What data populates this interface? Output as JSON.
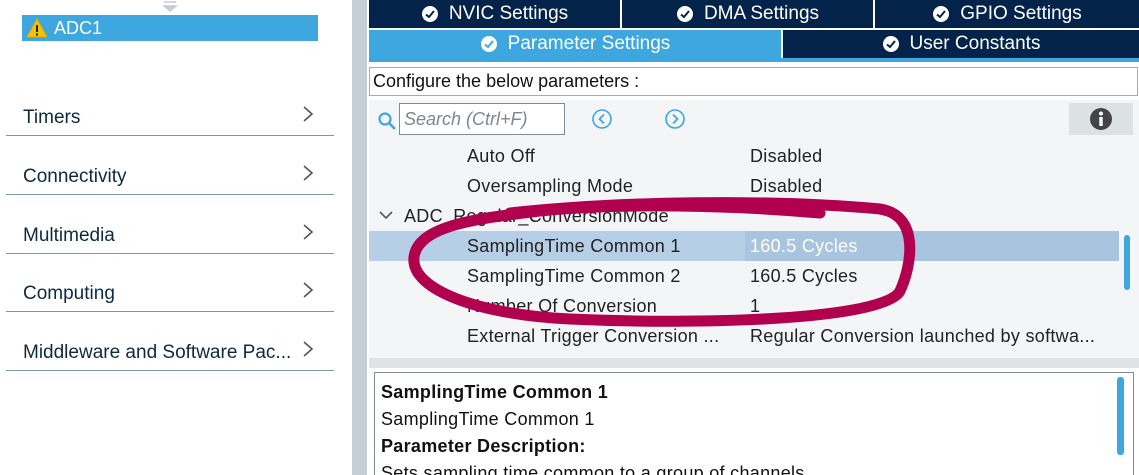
{
  "sidebar": {
    "selected_item": {
      "label": "ADC1",
      "icon": "warning-icon"
    },
    "categories": [
      {
        "label": "Timers"
      },
      {
        "label": "Connectivity"
      },
      {
        "label": "Multimedia"
      },
      {
        "label": "Computing"
      },
      {
        "label": "Middleware and Software Pac..."
      }
    ]
  },
  "tabs": {
    "row1": [
      {
        "label": "NVIC Settings"
      },
      {
        "label": "DMA Settings"
      },
      {
        "label": "GPIO Settings"
      }
    ],
    "row2": [
      {
        "label": "Parameter Settings",
        "active": true
      },
      {
        "label": "User Constants"
      }
    ]
  },
  "config": {
    "caption": "Configure the below parameters :"
  },
  "search": {
    "placeholder": "Search (Ctrl+F)"
  },
  "parameters": {
    "rows": [
      {
        "name": "Auto Off",
        "value": "Disabled"
      },
      {
        "name": "Oversampling Mode",
        "value": "Disabled"
      },
      {
        "name": "ADC_Regular_ConversionMode",
        "value": "",
        "group": true
      },
      {
        "name": "SamplingTime Common 1",
        "value": "160.5 Cycles",
        "selected": true
      },
      {
        "name": "SamplingTime Common 2",
        "value": "160.5 Cycles"
      },
      {
        "name": "Number Of Conversion",
        "value": "1"
      },
      {
        "name": "External Trigger Conversion ...",
        "value": "Regular Conversion launched by softwa..."
      }
    ]
  },
  "description": {
    "title": "SamplingTime Common 1",
    "subtitle": "SamplingTime Common 1",
    "heading": "Parameter Description:",
    "text": "Sets sampling time common to a group of channels."
  },
  "colors": {
    "dark_tab": "#03234b",
    "light_tab": "#3fa7e0",
    "selection": "#b6cfe6",
    "annotation": "#b0004e"
  }
}
